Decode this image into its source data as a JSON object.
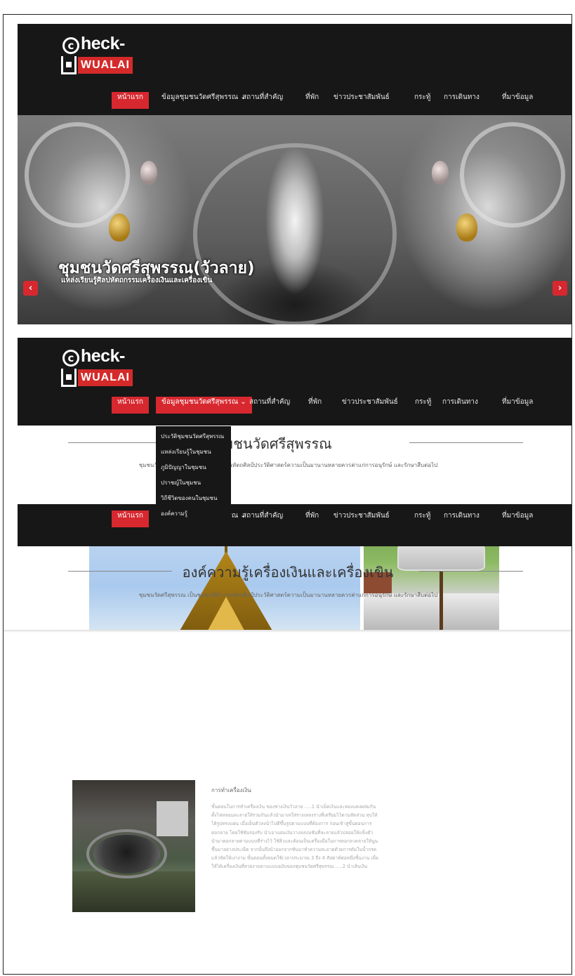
{
  "logo": {
    "mark": "c",
    "word": "heck-in",
    "sub": "WUALAI"
  },
  "nav": {
    "items": [
      {
        "label": "หน้าแรก"
      },
      {
        "label": "ข้อมูลชุมชนวัดศรีสุพรรณ ⌄"
      },
      {
        "label": "สถานที่สำคัญ"
      },
      {
        "label": "ที่พัก"
      },
      {
        "label": "ข่าวประชาสัมพันธ์"
      },
      {
        "label": "กระทู้"
      },
      {
        "label": "การเดินทาง"
      },
      {
        "label": "ที่มาข้อมูล"
      }
    ]
  },
  "hero": {
    "title": "ชุมชนวัดศรีสุพรรณ(วัวลาย)",
    "subtitle": "แหล่งเรียนรู้ศิลปหัตถกรรมเครื่องเงินและเครื่องเขิน",
    "prev": "‹",
    "next": "›"
  },
  "dropdown": {
    "items": [
      "ประวัติชุมชนวัดศรีสุพรรณ",
      "แหล่งเรียนรู้ในชุมชน",
      "ภูมิปัญญาในชุมชน",
      "ปราชญ์ในชุมชน",
      "วิถีชีวิตของคนในชุมชน",
      "องค์ความรู้"
    ]
  },
  "section2": {
    "title": "ประวัติชุมชนวัดศรีสุพรรณ",
    "subtitle": "ชุมชนวัดศรีสุพรรณ เป็นชุมชนที่ทำงานหัตถศิลป์ประวัติศาสตร์ความเป็นมานานหลายควรค่าแก่การอนุรักษ์ และรักษาสืบต่อไป"
  },
  "section3": {
    "title": "องค์ความรู้เครื่องเงินและเครื่องเขิน",
    "subtitle": "ชุมชนวัดศรีสุพรรณ เป็นชุมชนที่ทำงานหัตถศิลป์ประวัติศาสตร์ความเป็นมานานหลายควรค่าแก่การอนุรักษ์ และรักษาสืบต่อไป",
    "article": {
      "title": "การทำเครื่องเงิน",
      "body": "ขั้นตอนในการทำเครื่องเงิน ของช่างเงินวัวลาย .....1 นำเม็ดเงินและทองแดงผสมกัน ตั้งไฟหลอมละลายให้รวมกันแล้วนำมาเทใส่รางเทลงรางที่เตรียมไว้ตามสัดส่วน ทุบให้ได้รูปทรงแผ่น เมื่อเย็นตัวลงนำไปตีขึ้นรูปตามแบบที่ต้องการ ก่อนเข้าสู่ขั้นตอนการตอกลาย โดยใช้ชันรองรับ นำเอาแผ่นเงินวางลงบนชันที่ละลายแล้วปล่อยให้แข็งตัว นำมาตอกลายตามแบบที่ร่างไว้ ใช้สิ่วและค้อนเป็นเครื่องมือในการตอกลวดลายให้นูนขึ้นมาอย่างประณีต จากนั้นจึงนำออกจากชันมาทำความสะอาดด้วยการต้มในน้ำกรด แล้วขัดให้เงางาม ขั้นตอนทั้งหมดใช้เวลาประมาณ 3 ถึง 4 สัปดาห์ต่อหนึ่งชิ้นงาน เพื่อให้ได้เครื่องเงินที่สวยงามตามแบบฉบับของชุมชนวัดศรีสุพรรณ .....2 นำเส้นเงิน"
    }
  },
  "colors": {
    "accent": "#d7282f",
    "header_bg": "#171717"
  }
}
